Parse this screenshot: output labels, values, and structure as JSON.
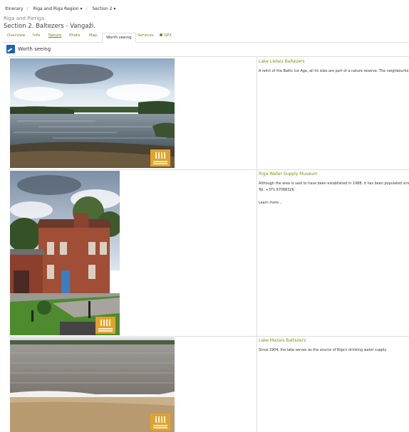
{
  "breadcrumb": [
    "Itinerary",
    "Riga and Riga Region ▾",
    "Section 2 ▾"
  ],
  "subtitle": "Riga and Pieriga.",
  "title": "Section 2. Baltezers - Vangaži.",
  "tabs": [
    "Overview",
    "Info",
    "Nature",
    "Photo",
    "Map",
    "Worth seeing",
    "Services",
    "GPX"
  ],
  "active_tab": "Worth seeing",
  "section_title": "Worth seeing",
  "items": [
    {
      "name": "Lake Lielais Baltezers",
      "text": "A relict of the Baltic Ice Age, all its isles are part of a nature reserve. The neighbourho"
    },
    {
      "name": "Riga Water Supply Museum",
      "text": "Although the area is said to have been established in 1988, it has been populated sinc",
      "phone": "Tel: +371 67088326.",
      "learn": "Learn more..."
    },
    {
      "name": "Lake Mazais Baltezers",
      "text": "Since 1904, the lake serves as the source of Riga's drinking water supply."
    }
  ],
  "colors": {
    "accent": "#8b8b1a",
    "icon_blue": "#1e63b0",
    "badge": "#e2a22a"
  }
}
